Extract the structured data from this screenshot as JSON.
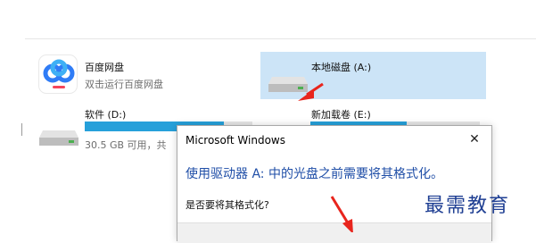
{
  "tiles": {
    "baidu": {
      "title": "百度网盘",
      "subtitle": "双击运行百度网盘"
    },
    "drive_a": {
      "title": "本地磁盘 (A:)"
    },
    "drive_d": {
      "title": "软件 (D:)",
      "free_text": "30.5 GB 可用，共",
      "used_fraction": 0.83
    },
    "drive_e": {
      "title": "新加载卷 (E:)",
      "used_fraction": 0.57
    }
  },
  "dialog": {
    "title": "Microsoft Windows",
    "close_glyph": "✕",
    "main_instruction": "使用驱动器 A: 中的光盘之前需要将其格式化。",
    "question": "是否要将其格式化?"
  },
  "watermark": "最需教育",
  "colors": {
    "selection": "#cce4f7",
    "capacity_fill": "#26a0da",
    "link_blue": "#1f4ea7",
    "arrow_red": "#e8251d"
  }
}
